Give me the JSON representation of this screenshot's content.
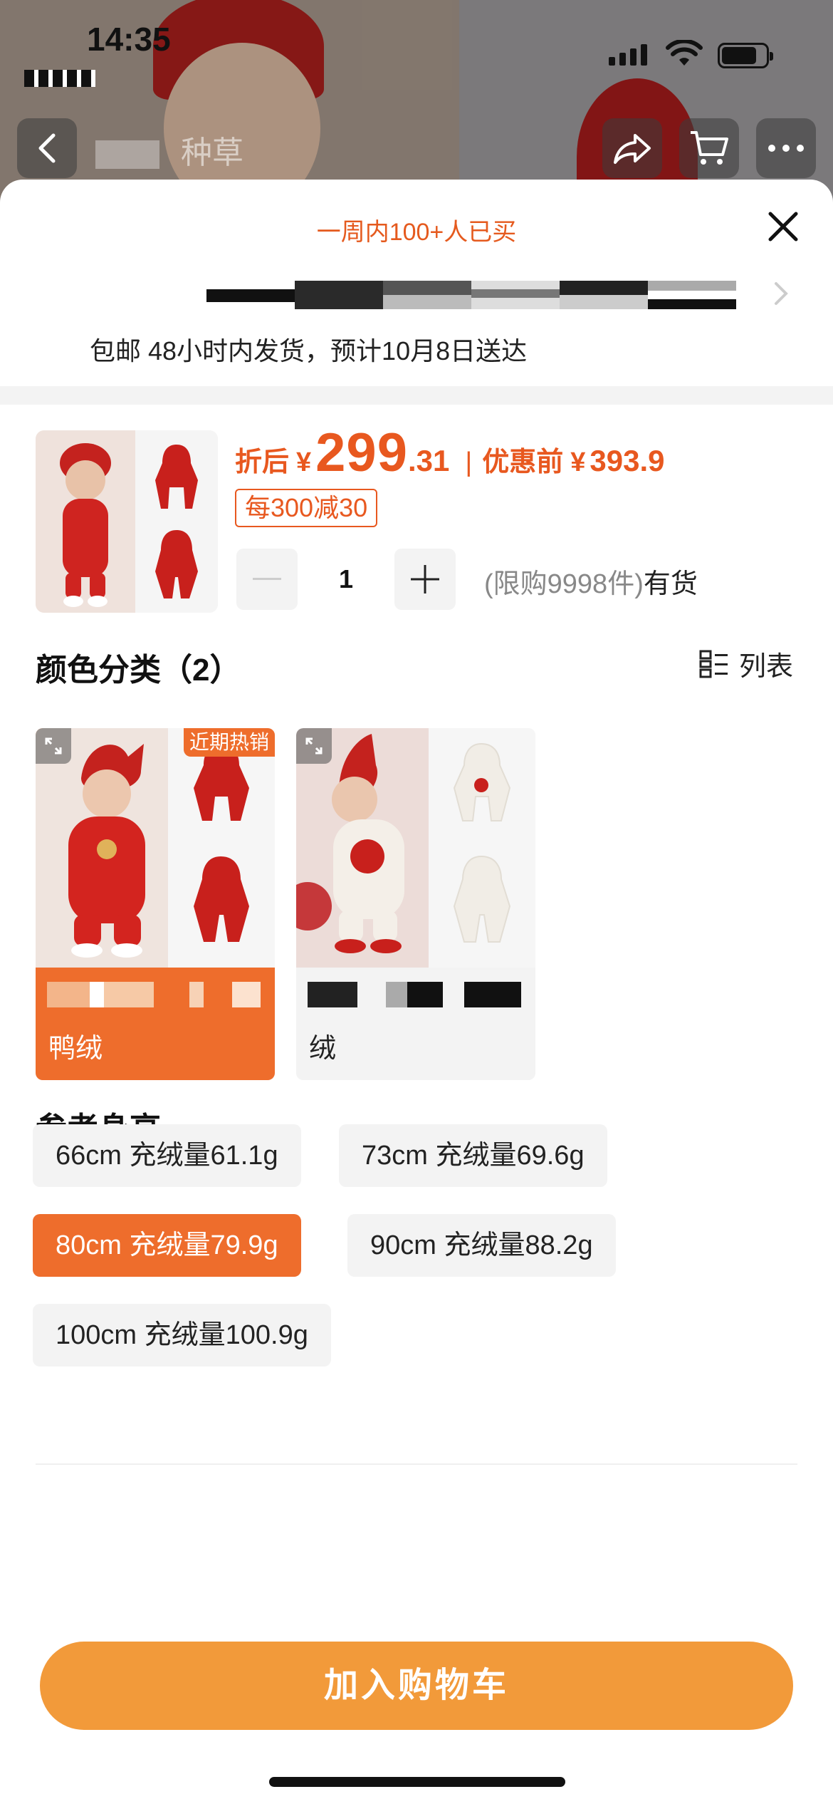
{
  "status_bar": {
    "time": "14:35"
  },
  "header": {
    "title": "种草"
  },
  "sheet": {
    "sold_hint": "一周内100+人已买",
    "delivery": "包邮 48小时内发货，预计10月8日送达"
  },
  "product": {
    "price_label": "折后",
    "currency": "¥",
    "price_int": "299",
    "price_dec": ".31",
    "before_label": "优惠前",
    "before_value": "393.9",
    "promo": "每300减30",
    "quantity": "1",
    "stock_limit": "(限购9998件)",
    "stock_status": "有货"
  },
  "colors": {
    "title": "颜色分类（2）",
    "list_toggle": "列表",
    "items": [
      {
        "name": "鸭绒",
        "badge": "近期热销",
        "selected": true
      },
      {
        "name": "绒",
        "badge": "",
        "selected": false
      }
    ]
  },
  "sizes": {
    "title": "参考身高",
    "items": [
      {
        "label": "66cm 充绒量61.1g",
        "selected": false
      },
      {
        "label": "73cm 充绒量69.6g",
        "selected": false
      },
      {
        "label": "80cm 充绒量79.9g",
        "selected": true
      },
      {
        "label": "90cm 充绒量88.2g",
        "selected": false
      },
      {
        "label": "100cm 充绒量100.9g",
        "selected": false
      }
    ]
  },
  "actions": {
    "add_to_cart": "加入购物车"
  },
  "colors_palette": {
    "accent": "#ee6d2c",
    "price": "#e8581f",
    "cart_button": "#f29a3a"
  }
}
